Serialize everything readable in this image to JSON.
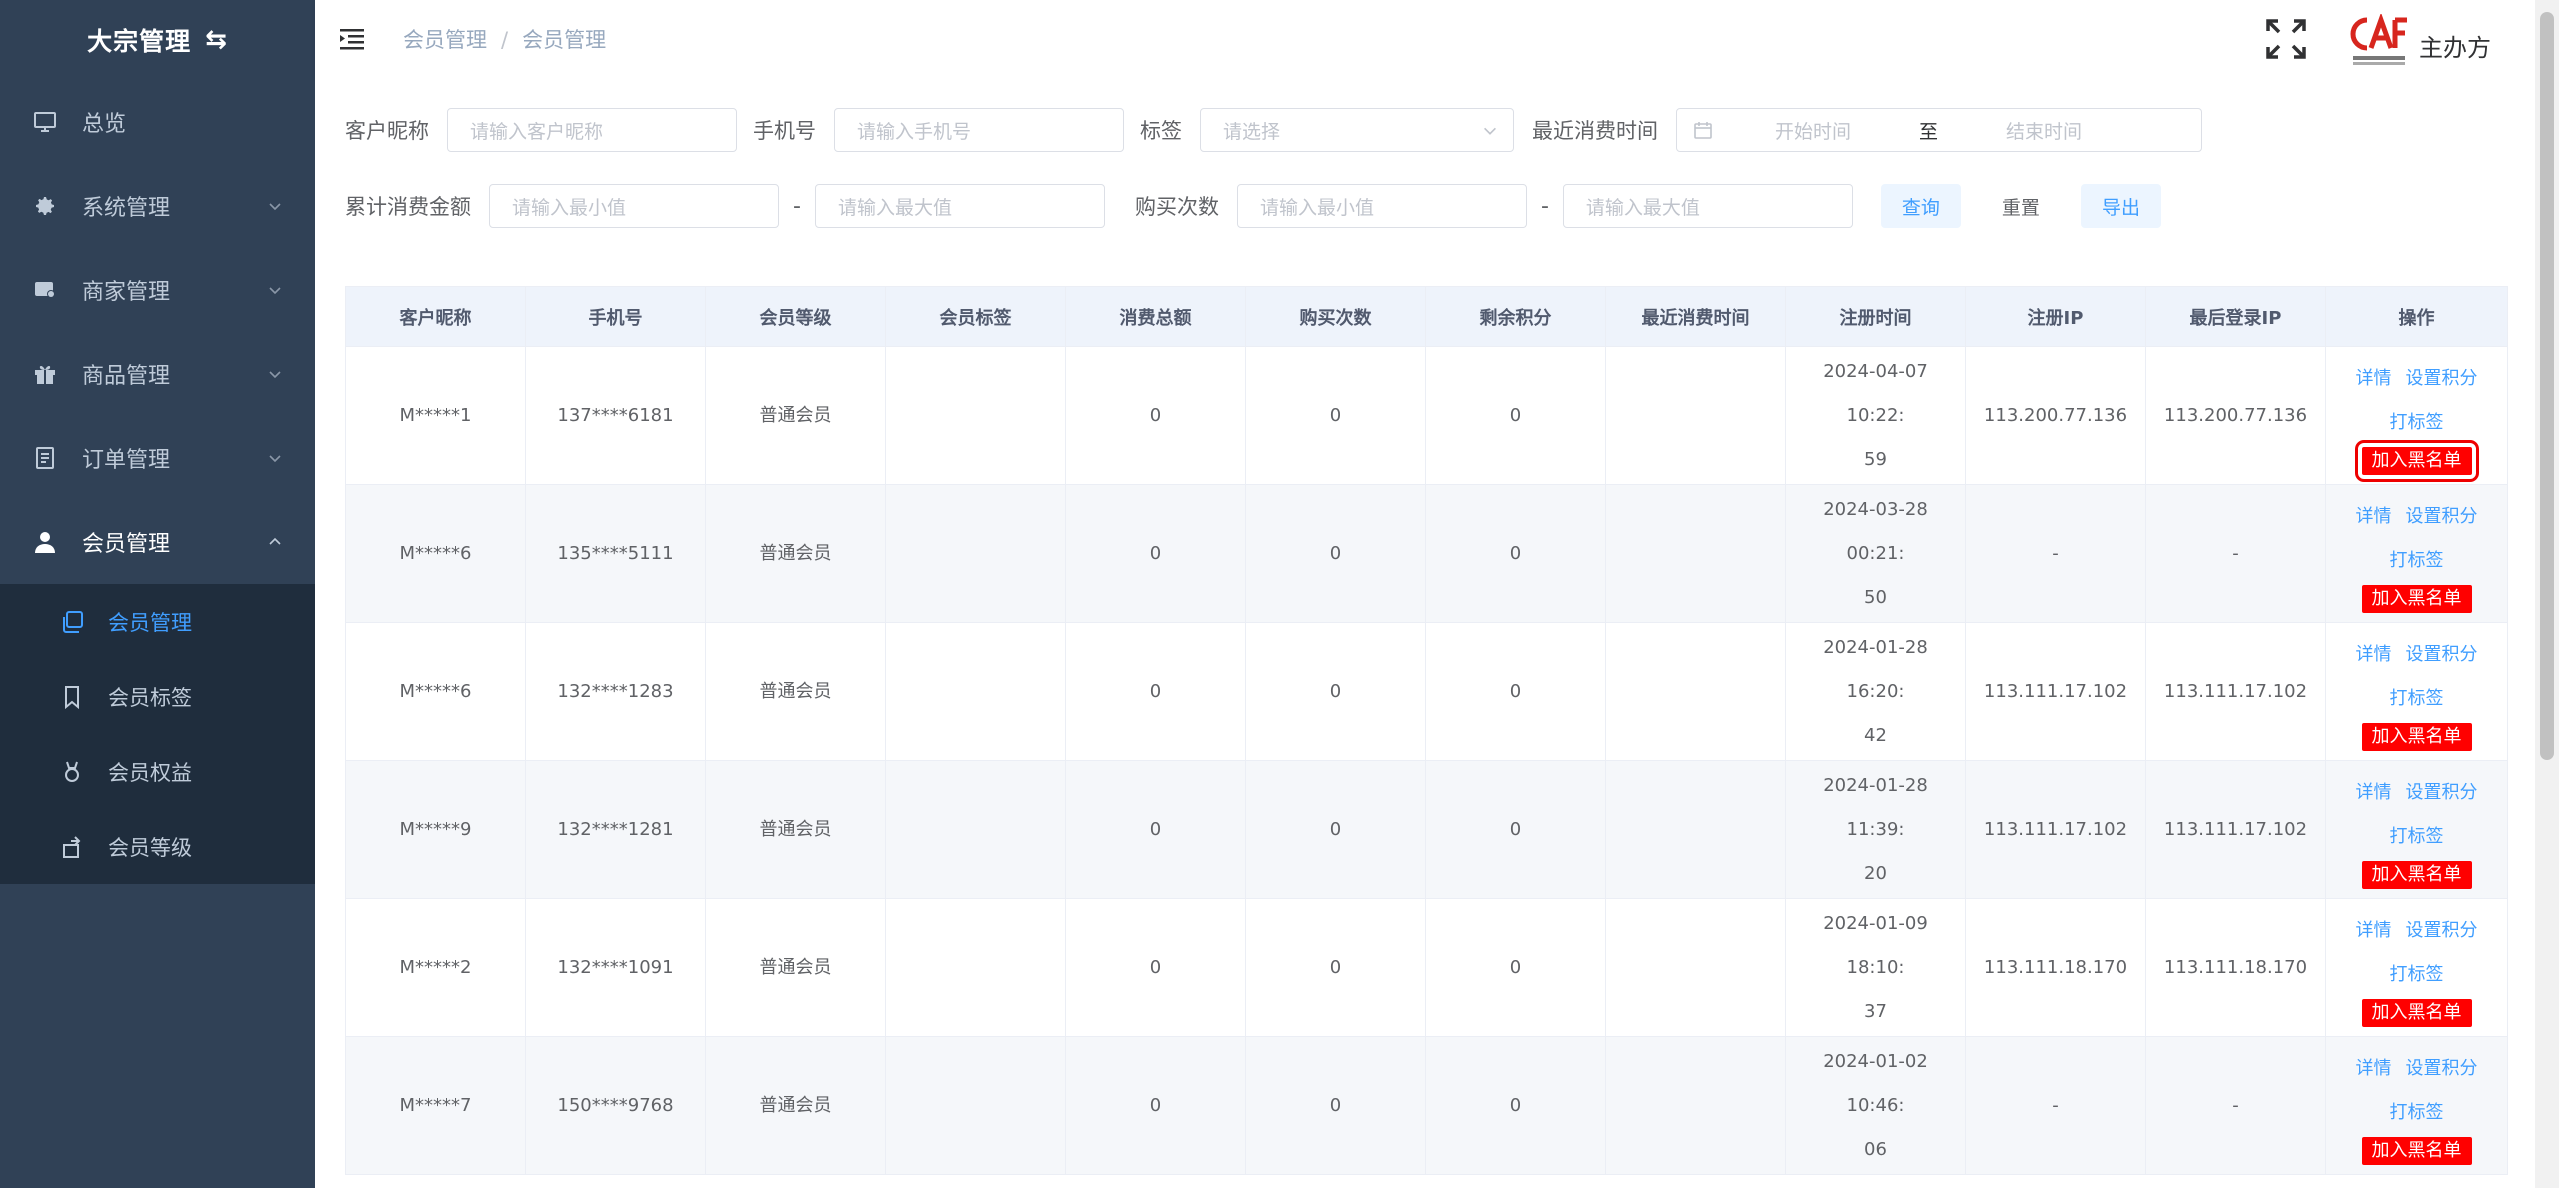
{
  "sidebar": {
    "title": "大宗管理",
    "items": [
      {
        "label": "总览",
        "icon": "monitor-icon"
      },
      {
        "label": "系统管理",
        "icon": "gear-icon"
      },
      {
        "label": "商家管理",
        "icon": "store-icon"
      },
      {
        "label": "商品管理",
        "icon": "gift-icon"
      },
      {
        "label": "订单管理",
        "icon": "document-icon"
      },
      {
        "label": "会员管理",
        "icon": "user-icon"
      }
    ],
    "submenu": [
      {
        "label": "会员管理",
        "icon": "copy-icon",
        "active": true
      },
      {
        "label": "会员标签",
        "icon": "bookmark-icon"
      },
      {
        "label": "会员权益",
        "icon": "medal-icon"
      },
      {
        "label": "会员等级",
        "icon": "level-icon"
      }
    ]
  },
  "header": {
    "breadcrumb": [
      "会员管理",
      "会员管理"
    ],
    "host_label": "主办方"
  },
  "filters": {
    "nickname_label": "客户昵称",
    "nickname_placeholder": "请输入客户昵称",
    "phone_label": "手机号",
    "phone_placeholder": "请输入手机号",
    "tag_label": "标签",
    "tag_placeholder": "请选择",
    "recent_label": "最近消费时间",
    "start_placeholder": "开始时间",
    "range_sep": "至",
    "end_placeholder": "结束时间",
    "amount_label": "累计消费金额",
    "min_placeholder": "请输入最小值",
    "max_placeholder": "请输入最大值",
    "dash": "-",
    "count_label": "购买次数",
    "query_btn": "查询",
    "reset_btn": "重置",
    "export_btn": "导出"
  },
  "table": {
    "columns": [
      "客户昵称",
      "手机号",
      "会员等级",
      "会员标签",
      "消费总额",
      "购买次数",
      "剩余积分",
      "最近消费时间",
      "注册时间",
      "注册IP",
      "最后登录IP",
      "操作"
    ],
    "actions": {
      "detail": "详情",
      "set_points": "设置积分",
      "tag": "打标签",
      "blacklist": "加入黑名单"
    },
    "rows": [
      {
        "nickname": "M*****1",
        "phone": "137****6181",
        "level": "普通会员",
        "tags": "",
        "total": "0",
        "count": "0",
        "points": "0",
        "recent": "",
        "reg_time_a": "2024-04-07 10:22:",
        "reg_time_b": "59",
        "reg_ip": "113.200.77.136",
        "last_ip": "113.200.77.136"
      },
      {
        "nickname": "M*****6",
        "phone": "135****5111",
        "level": "普通会员",
        "tags": "",
        "total": "0",
        "count": "0",
        "points": "0",
        "recent": "",
        "reg_time_a": "2024-03-28 00:21:",
        "reg_time_b": "50",
        "reg_ip": "-",
        "last_ip": "-"
      },
      {
        "nickname": "M*****6",
        "phone": "132****1283",
        "level": "普通会员",
        "tags": "",
        "total": "0",
        "count": "0",
        "points": "0",
        "recent": "",
        "reg_time_a": "2024-01-28 16:20:",
        "reg_time_b": "42",
        "reg_ip": "113.111.17.102",
        "last_ip": "113.111.17.102"
      },
      {
        "nickname": "M*****9",
        "phone": "132****1281",
        "level": "普通会员",
        "tags": "",
        "total": "0",
        "count": "0",
        "points": "0",
        "recent": "",
        "reg_time_a": "2024-01-28 11:39:",
        "reg_time_b": "20",
        "reg_ip": "113.111.17.102",
        "last_ip": "113.111.17.102"
      },
      {
        "nickname": "M*****2",
        "phone": "132****1091",
        "level": "普通会员",
        "tags": "",
        "total": "0",
        "count": "0",
        "points": "0",
        "recent": "",
        "reg_time_a": "2024-01-09 18:10:",
        "reg_time_b": "37",
        "reg_ip": "113.111.18.170",
        "last_ip": "113.111.18.170"
      },
      {
        "nickname": "M*****7",
        "phone": "150****9768",
        "level": "普通会员",
        "tags": "",
        "total": "0",
        "count": "0",
        "points": "0",
        "recent": "",
        "reg_time_a": "2024-01-02 10:46:",
        "reg_time_b": "06",
        "reg_ip": "-",
        "last_ip": "-"
      }
    ]
  },
  "colors": {
    "sidebar_bg": "#304156",
    "submenu_bg": "#1f2d3d",
    "accent": "#409eff",
    "danger": "#ff0000"
  }
}
